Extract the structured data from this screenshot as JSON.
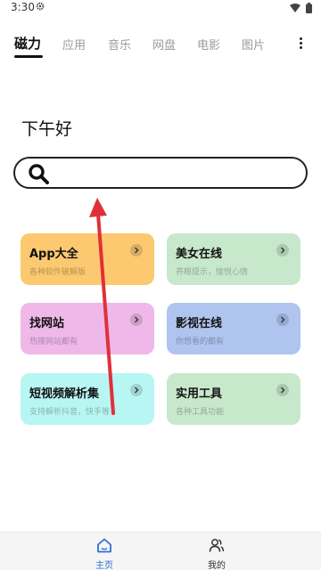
{
  "status_bar": {
    "time": "3:30"
  },
  "tabs": [
    {
      "label": "磁力",
      "active": true
    },
    {
      "label": "应用"
    },
    {
      "label": "音乐"
    },
    {
      "label": "网盘"
    },
    {
      "label": "电影"
    },
    {
      "label": "图片"
    }
  ],
  "greeting": "下午好",
  "search": {
    "placeholder": ""
  },
  "cards": [
    {
      "title": "App大全",
      "subtitle": "各种软件破解版",
      "color": "#FCC970"
    },
    {
      "title": "美女在线",
      "subtitle": "养眼提示，愉悦心情",
      "color": "#C8E8CC"
    },
    {
      "title": "找网站",
      "subtitle": "热搜网站都有",
      "color": "#EFB8E8"
    },
    {
      "title": "影视在线",
      "subtitle": "你想看的都有",
      "color": "#AFC4EF"
    },
    {
      "title": "短视频解析集",
      "subtitle": "支持解析抖音，快手等",
      "color": "#B8F6F4"
    },
    {
      "title": "实用工具",
      "subtitle": "各种工具功能",
      "color": "#C8E8CC"
    }
  ],
  "bottom_nav": [
    {
      "label": "主页",
      "active": true,
      "icon": "home-icon",
      "color": "#2F6FD6"
    },
    {
      "label": "我的",
      "active": false,
      "icon": "users-icon",
      "color": "#333333"
    }
  ],
  "annotation_color": "#E0303A"
}
